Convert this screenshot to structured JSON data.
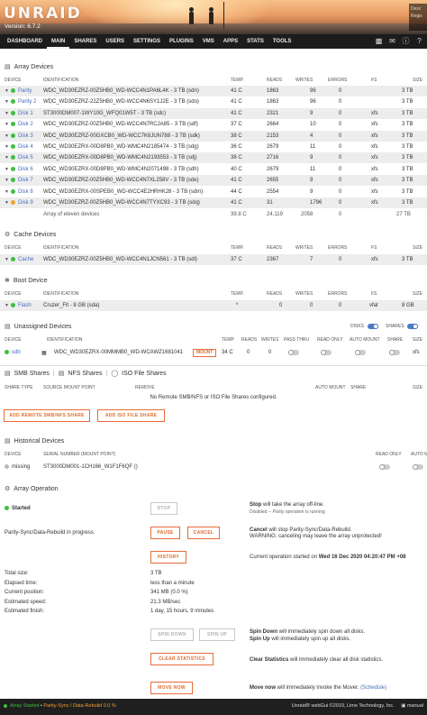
{
  "header": {
    "logo": "UNRAID",
    "version": "Version: 6.7.2",
    "right_text_1": "Desc",
    "right_text_2": "Regis"
  },
  "nav": {
    "items": [
      "DASHBOARD",
      "MAIN",
      "SHARES",
      "USERS",
      "SETTINGS",
      "PLUGINS",
      "VMS",
      "APPS",
      "STATS",
      "TOOLS"
    ],
    "active": "MAIN"
  },
  "array_devices": {
    "title": "Array Devices",
    "columns": [
      "DEVICE",
      "IDENTIFICATION",
      "TEMP.",
      "READS",
      "WRITES",
      "ERRORS",
      "FS",
      "SIZE"
    ],
    "rows": [
      {
        "device": "Parity",
        "id": "WDC_WD30EZRZ-00Z5HB0_WD-WCC4N1PA6L4K - 3 TB (sdn)",
        "temp": "41 C",
        "reads": "1863",
        "writes": "96",
        "errors": "0",
        "fs": "",
        "size": "3 TB",
        "status": "green"
      },
      {
        "device": "Parity 2",
        "id": "WDC_WD30EZRZ-22Z5HB0_WD-WCC4N6SY1J2E - 3 TB (sdo)",
        "temp": "41 C",
        "reads": "1863",
        "writes": "96",
        "errors": "0",
        "fs": "",
        "size": "3 TB",
        "status": "green"
      },
      {
        "device": "Disk 1",
        "id": "ST3000DM007-1WY10G_WFQ01W5T - 3 TB (sdc)",
        "temp": "41 C",
        "reads": "2321",
        "writes": "9",
        "errors": "0",
        "fs": "xfs",
        "size": "3 TB",
        "status": "green"
      },
      {
        "device": "Disk 2",
        "id": "WDC_WD30EZRZ-00Z5HB0_WD-WCC4N7RCJA85 - 3 TB (sdf)",
        "temp": "37 C",
        "reads": "2664",
        "writes": "10",
        "errors": "0",
        "fs": "xfs",
        "size": "3 TB",
        "status": "green"
      },
      {
        "device": "Disk 3",
        "id": "WDC_WD30EZRZ-00GXCB0_WD-WCC7K6JUN788 - 3 TB (sdk)",
        "temp": "38 C",
        "reads": "2153",
        "writes": "4",
        "errors": "0",
        "fs": "xfs",
        "size": "3 TB",
        "status": "green"
      },
      {
        "device": "Disk 4",
        "id": "WDC_WD30EZRX-00D8PB0_WD-WMC4N2185474 - 3 TB (sdg)",
        "temp": "36 C",
        "reads": "2679",
        "writes": "11",
        "errors": "0",
        "fs": "xfs",
        "size": "3 TB",
        "status": "green"
      },
      {
        "device": "Disk 5",
        "id": "WDC_WD30EZRX-00D8PB0_WD-WMC4N2193553 - 3 TB (sdj)",
        "temp": "38 C",
        "reads": "2716",
        "writes": "9",
        "errors": "0",
        "fs": "xfs",
        "size": "3 TB",
        "status": "green"
      },
      {
        "device": "Disk 6",
        "id": "WDC_WD30EZRX-00D8PB0_WD-WMC4N2071498 - 3 TB (sdh)",
        "temp": "40 C",
        "reads": "2679",
        "writes": "11",
        "errors": "0",
        "fs": "xfs",
        "size": "3 TB",
        "status": "green"
      },
      {
        "device": "Disk 7",
        "id": "WDC_WD30EZRZ-00Z5HB0_WD-WCC4N7XL258V - 3 TB (sde)",
        "temp": "41 C",
        "reads": "2655",
        "writes": "9",
        "errors": "0",
        "fs": "xfs",
        "size": "3 TB",
        "status": "green"
      },
      {
        "device": "Disk 8",
        "id": "WDC_WD30EZRX-00SPEB0_WD-WCC4E2HRHK28 - 3 TB (sdm)",
        "temp": "44 C",
        "reads": "2554",
        "writes": "9",
        "errors": "0",
        "fs": "xfs",
        "size": "3 TB",
        "status": "green"
      },
      {
        "device": "Disk 9",
        "id": "WDC_WD30EZRZ-00Z5HB0_WD-WCC4N7TYXC93 - 3 TB (sdq)",
        "temp": "41 C",
        "reads": "31",
        "writes": "1796",
        "errors": "0",
        "fs": "xfs",
        "size": "3 TB",
        "status": "orange"
      }
    ],
    "total": {
      "label": "Array of eleven devices",
      "temp": "39.8 C",
      "reads": "24,119",
      "writes": "2058",
      "errors": "0",
      "size": "27 TB"
    }
  },
  "cache_devices": {
    "title": "Cache Devices",
    "columns": [
      "DEVICE",
      "IDENTIFICATION",
      "TEMP.",
      "READS",
      "WRITES",
      "ERRORS",
      "FS",
      "SIZE"
    ],
    "rows": [
      {
        "device": "Cache",
        "id": "WDC_WD30EZRZ-00Z5HB0_WD-WCC4N1JCN561 - 3 TB (sdl)",
        "temp": "37 C",
        "reads": "2367",
        "writes": "7",
        "errors": "0",
        "fs": "xfs",
        "size": "3 TB"
      }
    ]
  },
  "boot_device": {
    "title": "Boot Device",
    "columns": [
      "DEVICE",
      "IDENTIFICATION",
      "TEMP.",
      "READS",
      "WRITES",
      "ERRORS",
      "FS",
      "SIZE"
    ],
    "rows": [
      {
        "device": "Flash",
        "id": "Cruzer_Fit - 8 GB (sda)",
        "temp": "*",
        "reads": "0",
        "writes": "0",
        "errors": "0",
        "fs": "vfat",
        "size": "8 GB"
      }
    ]
  },
  "unassigned": {
    "title": "Unassigned Devices",
    "disks_label": "DISKS",
    "shares_label": "SHARES",
    "columns": [
      "DEVICE",
      "IDENTIFICATION",
      "TEMP",
      "READS",
      "WRITES",
      "PASS THRU",
      "READ ONLY",
      "AUTO MOUNT",
      "SHARE",
      "SIZE"
    ],
    "row": {
      "device": "sdb",
      "id": "WDC_WD30EZRX-00MMMB0_WD-WCAWZ1681041",
      "mount": "MOUNT",
      "temp": "34 C",
      "reads": "0",
      "writes": "0",
      "fs": "xfs"
    },
    "tabs": [
      "SMB Shares",
      "NFS Shares",
      "ISO File Shares"
    ],
    "share_columns": [
      "SHARE TYPE",
      "SOURCE MOUNT POINT",
      "REMOVE",
      "AUTO MOUNT",
      "SHARE",
      "SIZE"
    ],
    "no_shares": "No Remote SMB/NFS or ISO File Shares configured.",
    "add_remote_btn": "ADD REMOTE SMB/NFS SHARE",
    "add_iso_btn": "ADD ISO FILE SHARE"
  },
  "historical": {
    "title": "Historical Devices",
    "columns": [
      "DEVICE",
      "SERIAL NUMBER (MOUNT POINT)",
      "READ ONLY",
      "AUTO MOUNT"
    ],
    "row": {
      "device": "missing",
      "serial": "ST3000DM001-1CH166_W1F1F6QF ()"
    }
  },
  "array_operation": {
    "title": "Array Operation",
    "status": "Started",
    "stop_btn": "STOP",
    "stop_desc_b": "Stop",
    "stop_desc_1": " will take the array off-line.",
    "stop_desc_2": "Disabled -- Parity operation is running",
    "parity_label": "Parity-Sync/Data-Rebuild in progress.",
    "pause_btn": "PAUSE",
    "cancel_btn": "CANCEL",
    "cancel_desc_b": "Cancel",
    "cancel_desc_1": " will stop Parity-Sync/Data-Rebuild.",
    "cancel_desc_2": "WARNING: canceling may leave the array unprotected!",
    "history_btn": "HISTORY",
    "op_started": "Current operation started on ",
    "op_started_b": "Wed 16 Dec 2020 04:20:47 PM +08",
    "stats": [
      {
        "label": "Total size:",
        "value": "3 TB"
      },
      {
        "label": "Elapsed time:",
        "value": "less than a minute"
      },
      {
        "label": "Current position:",
        "value": "341 MB (0.0 %)"
      },
      {
        "label": "Estimated speed:",
        "value": "21.3 MB/sec"
      },
      {
        "label": "Estimated finish:",
        "value": "1 day, 15 hours, 9 minutes"
      }
    ],
    "spin_down_btn": "SPIN DOWN",
    "spin_up_btn": "SPIN UP",
    "spin_down_b": "Spin Down",
    "spin_down_desc": " will immediately spin down all disks.",
    "spin_up_b": "Spin Up",
    "spin_up_desc": " will immediately spin up all disks.",
    "clear_btn": "CLEAR STATISTICS",
    "clear_b": "Clear Statistics",
    "clear_desc": " will immediately clear all disk statistics.",
    "move_btn": "MOVE NOW",
    "move_b": "Move now",
    "move_desc": " will immediately invoke the Mover. ",
    "schedule_link": "(Schedule)"
  },
  "footer": {
    "status": "Array Started",
    "sep": " • ",
    "op": "Parity-Sync / Data-Rebuild 0.0 %",
    "copyright": "Unraid® webGui ©2019, Lime Technology, Inc.",
    "manual": "manual"
  },
  "colors": {
    "accent": "#e86c3a",
    "link": "#486dba",
    "green": "#3fbf3f",
    "orange": "#f0a030",
    "nav_bg": "#1c1c1c"
  }
}
